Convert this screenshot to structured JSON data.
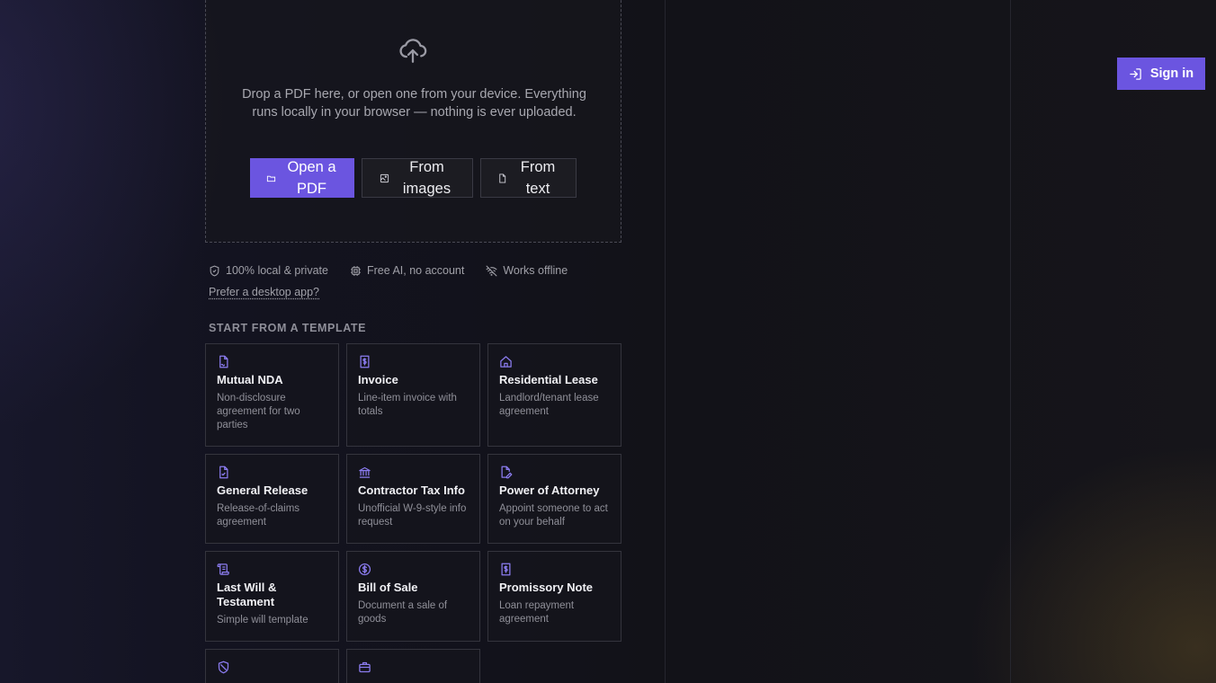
{
  "upload": {
    "icon": "cloud-upload-icon",
    "text": "Drop a PDF here, or open one from your device. Everything runs locally in your browser — nothing is ever uploaded.",
    "buttons": {
      "open_pdf": "Open a PDF",
      "from_images": "From images",
      "from_text": "From text"
    }
  },
  "features": [
    {
      "icon": "shield-check-icon",
      "label": "100% local & private"
    },
    {
      "icon": "chip-icon",
      "label": "Free AI, no account"
    },
    {
      "icon": "wifi-off-icon",
      "label": "Works offline"
    }
  ],
  "desktop_link": "Prefer a desktop app?",
  "templates_heading": "START FROM A TEMPLATE",
  "templates": [
    {
      "icon": "file-signature-icon",
      "title": "Mutual NDA",
      "desc": "Non-disclosure agreement for two parties"
    },
    {
      "icon": "receipt-dollar-icon",
      "title": "Invoice",
      "desc": "Line-item invoice with totals"
    },
    {
      "icon": "house-icon",
      "title": "Residential Lease",
      "desc": "Landlord/tenant lease agreement"
    },
    {
      "icon": "file-check-icon",
      "title": "General Release",
      "desc": "Release-of-claims agreement"
    },
    {
      "icon": "bank-icon",
      "title": "Contractor Tax Info",
      "desc": "Unofficial W-9-style info request"
    },
    {
      "icon": "file-pen-icon",
      "title": "Power of Attorney",
      "desc": "Appoint someone to act on your behalf"
    },
    {
      "icon": "scroll-icon",
      "title": "Last Will & Testament",
      "desc": "Simple will template"
    },
    {
      "icon": "dollar-circle-icon",
      "title": "Bill of Sale",
      "desc": "Document a sale of goods"
    },
    {
      "icon": "receipt-dollar-icon",
      "title": "Promissory Note",
      "desc": "Loan repayment agreement"
    },
    {
      "icon": "shield-icon",
      "title": "",
      "desc": ""
    },
    {
      "icon": "briefcase-icon",
      "title": "",
      "desc": ""
    }
  ],
  "auth": {
    "sign_in": "Sign in",
    "icon": "log-in-icon"
  },
  "colors": {
    "accent": "#6b55e0",
    "icon_purple": "#8b7cf0"
  }
}
